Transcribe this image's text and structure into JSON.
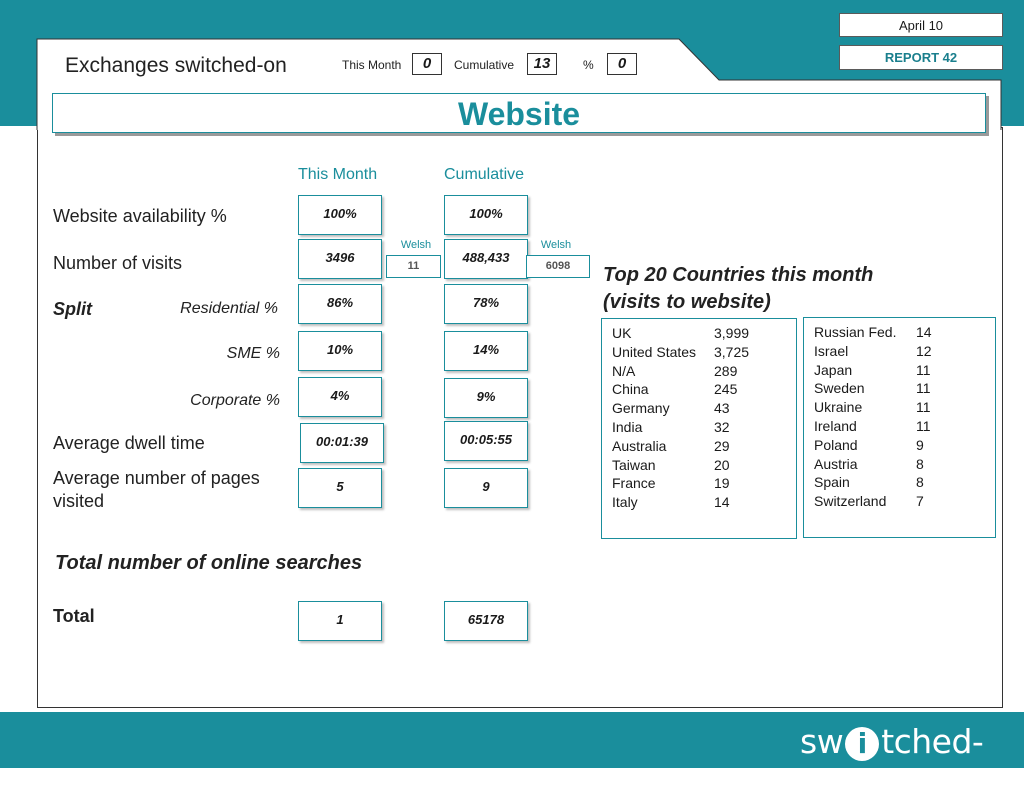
{
  "header": {
    "date": "April 10",
    "report": "REPORT 42",
    "title": "Exchanges switched-on",
    "this_month_label": "This Month",
    "this_month_value": "0",
    "cumulative_label": "Cumulative",
    "cumulative_value": "13",
    "percent_label": "%",
    "percent_value": "0"
  },
  "banner": {
    "title": "Website"
  },
  "columns": {
    "this_month": "This Month",
    "cumulative": "Cumulative"
  },
  "welsh_label": "Welsh",
  "rows": {
    "availability": {
      "label": "Website availability %",
      "this_month": "100%",
      "cumulative": "100%"
    },
    "visits": {
      "label": "Number of visits",
      "this_month": "3496",
      "cumulative": "488,433",
      "welsh_month": "11",
      "welsh_cumulative": "6098"
    },
    "split": {
      "label": "Split"
    },
    "residential": {
      "label": "Residential %",
      "this_month": "86%",
      "cumulative": "78%"
    },
    "sme": {
      "label": "SME %",
      "this_month": "10%",
      "cumulative": "14%"
    },
    "corporate": {
      "label": "Corporate %",
      "this_month": "4%",
      "cumulative": "9%"
    },
    "dwell": {
      "label": "Average dwell time",
      "this_month": "00:01:39",
      "cumulative": "00:05:55"
    },
    "pages": {
      "label_line1": "Average number of pages",
      "label_line2": "visited",
      "this_month": "5",
      "cumulative": "9"
    }
  },
  "searches": {
    "heading": "Total number of online searches",
    "total_label": "Total",
    "this_month": "1",
    "cumulative": "65178"
  },
  "countries": {
    "title_line1": "Top 20 Countries this month",
    "title_line2": "(visits to website)",
    "left": [
      {
        "name": "UK",
        "value": "3,999"
      },
      {
        "name": "United States",
        "value": "3,725"
      },
      {
        "name": "N/A",
        "value": "289"
      },
      {
        "name": "China",
        "value": "245"
      },
      {
        "name": "Germany",
        "value": "43"
      },
      {
        "name": "India",
        "value": "32"
      },
      {
        "name": "Australia",
        "value": "29"
      },
      {
        "name": "Taiwan",
        "value": "20"
      },
      {
        "name": "France",
        "value": "19"
      },
      {
        "name": "Italy",
        "value": "14"
      }
    ],
    "right": [
      {
        "name": "Russian Fed.",
        "value": "14"
      },
      {
        "name": "Israel",
        "value": "12"
      },
      {
        "name": "Japan",
        "value": "11"
      },
      {
        "name": "Sweden",
        "value": "11"
      },
      {
        "name": "Ukraine",
        "value": "11"
      },
      {
        "name": "Ireland",
        "value": "11"
      },
      {
        "name": "Poland",
        "value": "9"
      },
      {
        "name": "Austria",
        "value": "8"
      },
      {
        "name": "Spain",
        "value": "8"
      },
      {
        "name": "Switzerland",
        "value": "7"
      }
    ]
  },
  "logo": {
    "prefix": "sw",
    "middle": "i",
    "suffix": "tched-on"
  },
  "colors": {
    "accent": "#1a8e9c"
  }
}
